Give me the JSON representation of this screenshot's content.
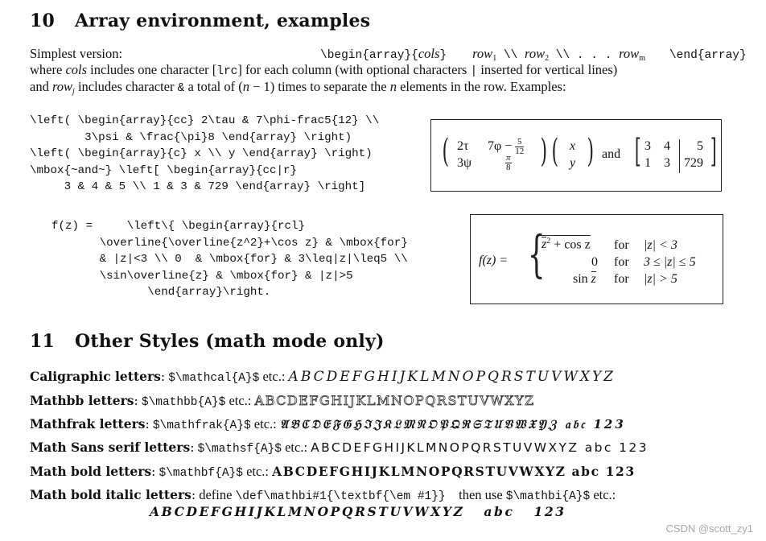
{
  "sections": [
    {
      "number": "10",
      "title": "Array environment, examples",
      "intro": {
        "line1_label": "Simplest version:",
        "line1_code_begin": "\\begin{array}{",
        "line1_cols": "cols",
        "line1_code_close": "}",
        "line1_rows": [
          "row",
          "1",
          " \\\\ ",
          "row",
          "2",
          " \\\\ . . . ",
          "row",
          "m"
        ],
        "line1_code_end": "\\end{array}",
        "line2_a": "where ",
        "line2_cols": "cols",
        "line2_b": " includes one character [",
        "line2_lrc": "lrc",
        "line2_c": "] for each column (with optional characters ",
        "line2_bar": "|",
        "line2_d": " inserted for vertical lines)",
        "line3_a": "and ",
        "line3_row": "row",
        "line3_sub": "j",
        "line3_b": " includes character ",
        "line3_amp": "&",
        "line3_c": " a total of (",
        "line3_n": "n",
        "line3_d": " − 1) times to separate the ",
        "line3_n2": "n",
        "line3_e": " elements in the row. Examples:"
      },
      "example1_code": "\\left( \\begin{array}{cc} 2\\tau & 7\\phi-frac5{12} \\\\\n        3\\psi & \\frac{\\pi}8 \\end{array} \\right)\n\\left( \\begin{array}{c} x \\\\ y \\end{array} \\right)\n\\mbox{~and~} \\left[ \\begin{array}{cc|r}\n     3 & 4 & 5 \\\\ 1 & 3 & 729 \\end{array} \\right]",
      "example1_render": {
        "m1": {
          "r1c1": "2τ",
          "r1c2_pre": "7φ − ",
          "r1c2_num": "5",
          "r1c2_den": "12",
          "r2c1": "3ψ",
          "r2c2_num": "π",
          "r2c2_den": "8"
        },
        "m2": {
          "r1": "x",
          "r2": "y"
        },
        "and": "and",
        "m3": {
          "r1": [
            "3",
            "4",
            "5"
          ],
          "r2": [
            "1",
            "3",
            "729"
          ]
        }
      },
      "example2_code": "f(z) =     \\left\\{ \\begin{array}{rcl}\n       \\overline{\\overline{z^2}+\\cos z} & \\mbox{for}\n       & |z|<3 \\\\ 0  & \\mbox{for} & 3\\leq|z|\\leq5 \\\\\n       \\sin\\overline{z} & \\mbox{for} & |z|>5\n              \\end{array}\\right.",
      "example2_render": {
        "lhs": "f(z) =",
        "rows": [
          {
            "left_a": "z",
            "left_sup": "2",
            "left_b": " + cos z",
            "mid": "for",
            "right": "|z| < 3"
          },
          {
            "left": "0",
            "mid": "for",
            "right": "3 ≤ |z| ≤ 5"
          },
          {
            "left_a": "sin ",
            "left_z": "z",
            "mid": "for",
            "right": "|z| > 5"
          }
        ]
      }
    },
    {
      "number": "11",
      "title": "Other Styles (math mode only)",
      "styles": [
        {
          "label": "Caligraphic letters",
          "cmd": "$\\mathcal{A}$",
          "etc": " etc.: ",
          "sample": "ABCDEFGHIJKLMNOPQRSTUVWXYZ"
        },
        {
          "label": "Mathbb letters",
          "cmd": "$\\mathbb{A}$",
          "etc": " etc.: ",
          "sample": "ABCDEFGHIJKLMNOPQRSTUVWXYZ"
        },
        {
          "label": "Mathfrak letters",
          "cmd": "$\\mathfrak{A}$",
          "etc": " etc.: ",
          "sample": "𝔄𝔅ℭ𝔇𝔈𝔉𝔊ℌℑ𝔍𝔎𝔏𝔐𝔑𝔒𝔓𝔔ℜ𝔖𝔗𝔘𝔙𝔚𝔛𝔜ℨ 𝔞𝔟𝔠 123"
        },
        {
          "label": "Math Sans serif letters",
          "cmd": "$\\mathsf{A}$",
          "etc": " etc.: ",
          "sample": "ABCDEFGHIJKLMNOPQRSTUVWXYZ abc 123"
        },
        {
          "label": "Math bold letters",
          "cmd": "$\\mathbf{A}$",
          "etc": " etc.: ",
          "sample": "ABCDEFGHIJKLMNOPQRSTUVWXYZ abc 123"
        },
        {
          "label": "Math bold italic letters",
          "define": " define ",
          "cmd": "\\def\\mathbi#1{\\textbf{\\em #1}}",
          "then": "    then use ",
          "cmd2": "$\\mathbi{A}$",
          "etc": " etc.:",
          "sample": "ABCDEFGHIJKLMNOPQRSTUVWXYZ   abc   123"
        }
      ]
    }
  ],
  "watermark": "CSDN @scott_zy1"
}
